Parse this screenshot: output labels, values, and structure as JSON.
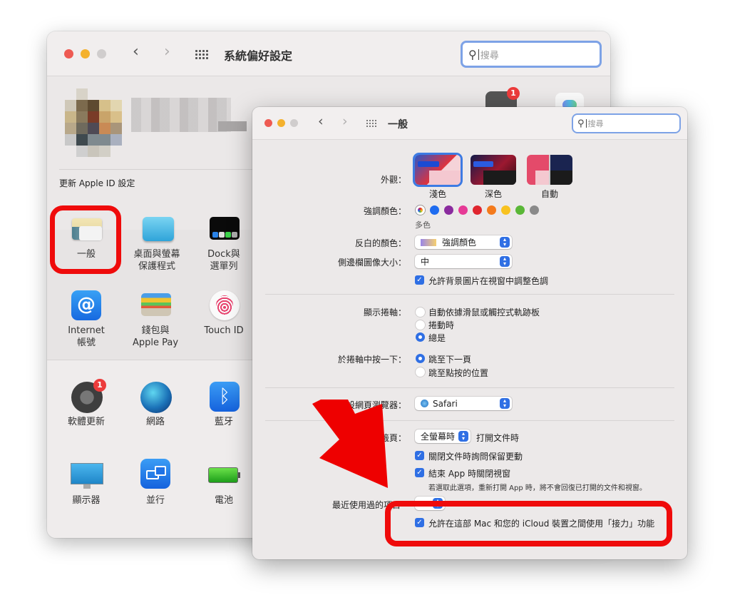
{
  "back_window": {
    "title": "系統偏好設定",
    "search_placeholder": "搜尋",
    "apple_id_update": "更新 Apple ID 設定",
    "apple_badge": "1",
    "tiles": [
      {
        "label": "一般",
        "icon": "general-icon"
      },
      {
        "label": "桌面與螢幕\n保護程式",
        "line1": "桌面與螢幕",
        "line2": "保護程式",
        "icon": "desktop-screensaver-icon"
      },
      {
        "label": "Dock與\n選單列",
        "line1": "Dock與",
        "line2": "選單列",
        "icon": "dock-menubar-icon"
      },
      {
        "label": "Internet\n帳號",
        "line1": "Internet",
        "line2": "帳號",
        "icon": "internet-accounts-icon"
      },
      {
        "label": "錢包與\nApple Pay",
        "line1": "錢包與",
        "line2": "Apple Pay",
        "icon": "wallet-icon"
      },
      {
        "label": "Touch ID",
        "icon": "fingerprint-icon"
      },
      {
        "label": "軟體更新",
        "icon": "software-update-icon",
        "badge": "1"
      },
      {
        "label": "網路",
        "icon": "network-globe-icon"
      },
      {
        "label": "藍牙",
        "icon": "bluetooth-icon"
      },
      {
        "label": "顯示器",
        "icon": "display-icon"
      },
      {
        "label": "並行",
        "icon": "sidecar-icon"
      },
      {
        "label": "電池",
        "icon": "battery-icon"
      }
    ]
  },
  "front_window": {
    "title": "一般",
    "search_placeholder": "搜尋",
    "appearance": {
      "label": "外觀：",
      "options": [
        "淺色",
        "深色",
        "自動"
      ],
      "selected": "淺色"
    },
    "accent_color": {
      "label": "強調顏色：",
      "selected_name": "多色",
      "colors": [
        "multicolor",
        "#1f6cf0",
        "#8a2b9e",
        "#e63a96",
        "#e0262f",
        "#f47a1c",
        "#f8c220",
        "#5ab737",
        "#8a8a8a"
      ]
    },
    "highlight_color": {
      "label": "反白的顏色：",
      "value": "強調顏色"
    },
    "sidebar_icon_size": {
      "label": "側邊欄圖像大小：",
      "value": "中"
    },
    "wallpaper_tinting": {
      "label": "允許背景圖片在視窗中調整色調",
      "checked": true
    },
    "show_scroll_bars": {
      "label": "顯示捲軸：",
      "options": [
        "自動依據滑鼠或觸控式軌跡板",
        "捲動時",
        "總是"
      ],
      "selected": "總是"
    },
    "click_scroll_bar": {
      "label": "於捲軸中按一下：",
      "options": [
        "跳至下一頁",
        "跳至點按的位置"
      ],
      "selected": "跳至下一頁"
    },
    "default_browser": {
      "label": "預設網頁瀏覽器：",
      "value": "Safari"
    },
    "prefer_tabs": {
      "label_partial": "好標籤頁：",
      "value": "全螢幕時",
      "suffix": "打開文件時"
    },
    "ask_keep_changes": {
      "label": "關閉文件時詢問保留更動",
      "checked": true
    },
    "close_windows_on_quit": {
      "label": "結束 App 時關閉視窗",
      "checked": true,
      "note": "若選取此選項，重新打開 App 時，將不會回復已打開的文件和視窗。"
    },
    "recent_items": {
      "label_partial": "最近使用過的項目"
    },
    "handoff": {
      "label": "允許在這部 Mac 和您的 iCloud 裝置之間使用「接力」功能",
      "checked": true
    }
  },
  "annotations": {
    "highlight_color": "#ef0b0b"
  }
}
